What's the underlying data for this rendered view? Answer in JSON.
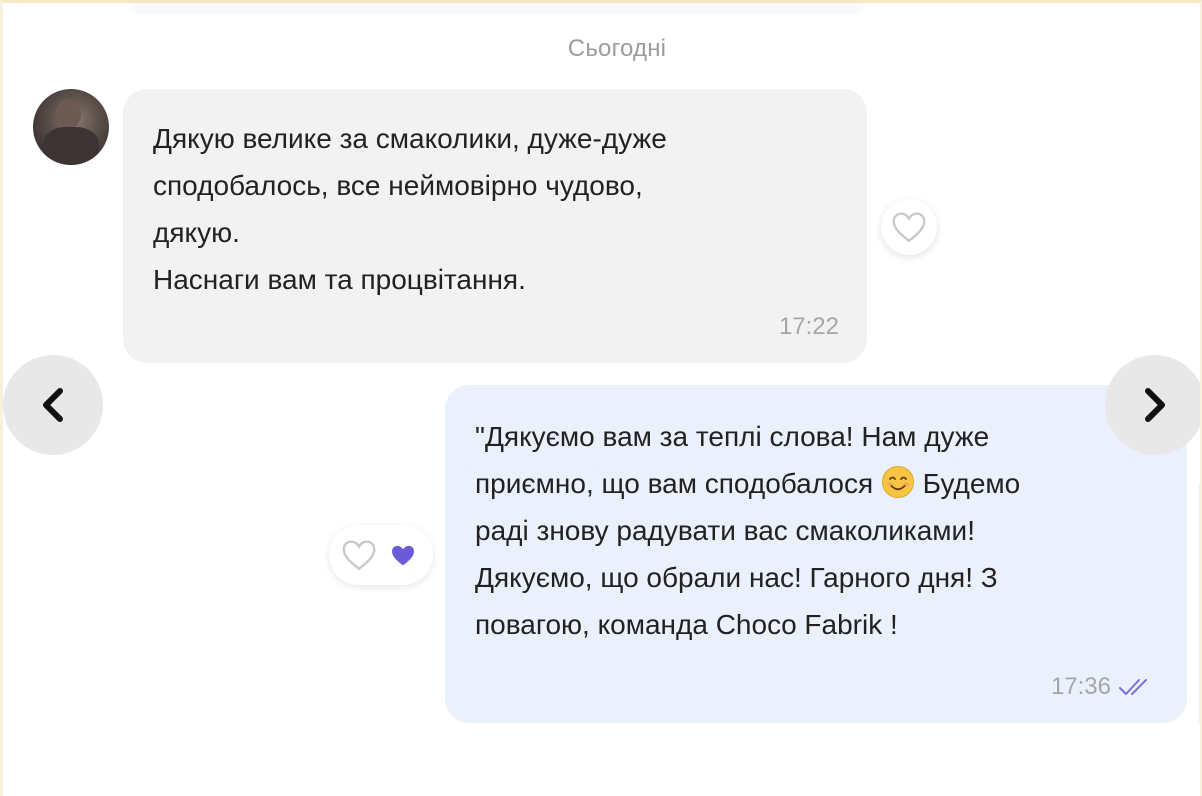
{
  "date_separator": "Сьогодні",
  "incoming_message": {
    "text": "Дякую велике за смаколики, дуже-дуже\nсподобалось, все неймовірно чудово,\nдякую.\nНаснаги вам та процвітання.",
    "time": "17:22",
    "bubble_color": "#f2f2f2"
  },
  "outgoing_message": {
    "text_part1": "\"Дякуємо вам за теплі слова! Нам дуже\nприємно, що вам сподобалося ",
    "emoji": "smiling-face-icon",
    "text_part2": " Будемо\nраді знову радувати вас смаколиками!\nДякуємо, що обрали нас! Гарного дня! З\nповагою, команда Choco Fabrik !",
    "time": "17:36",
    "status": "read",
    "bubble_color": "#eaf0fc"
  },
  "colors": {
    "accent": "#6b5bd6",
    "text": "#222222",
    "muted": "#a6a6a6"
  },
  "icons": {
    "prev": "chevron-left-icon",
    "next": "chevron-right-icon",
    "like": "heart-outline-icon",
    "reaction": "heart-filled-icon",
    "read": "double-check-icon"
  }
}
